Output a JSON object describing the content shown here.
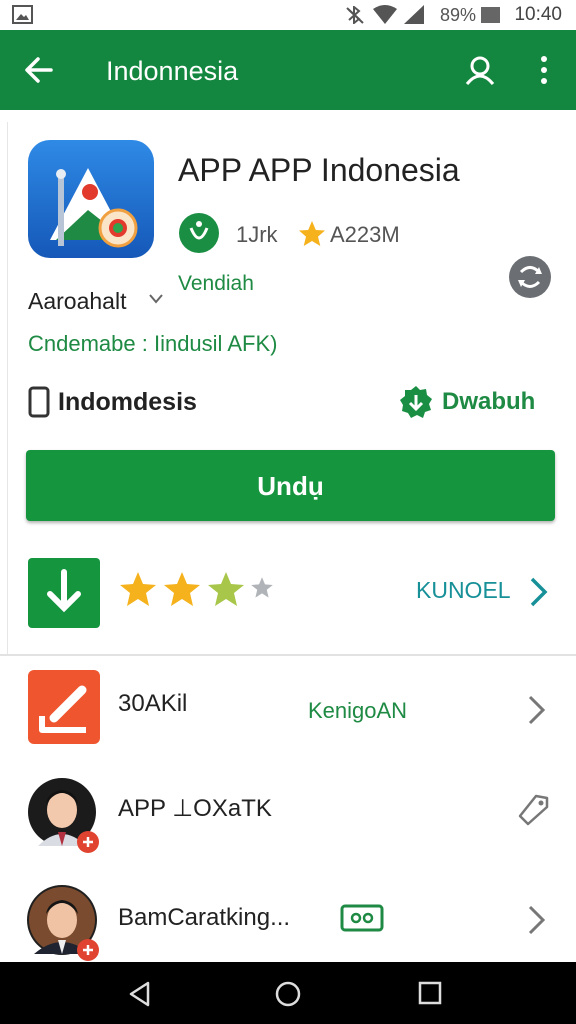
{
  "status_bar": {
    "battery": "89%",
    "time": "10:40"
  },
  "app_bar": {
    "title": "Indonnesia",
    "back_icon": "arrow-left-icon",
    "search_icon": "person-search-icon",
    "menu_icon": "more-vert-icon"
  },
  "app": {
    "title": "APP APP Indonesia",
    "meta_count": "1Jrk",
    "meta_size": "A223M",
    "vendor": "Vendiah",
    "age": "Aaroahalt",
    "compatibility": "Cndemabe : Iindusil AFK)",
    "device": "Indomdesis",
    "download_link": "Dwabuh"
  },
  "install": {
    "label": "Undụ"
  },
  "rating": {
    "stars": 3,
    "link": "KUNOEL"
  },
  "list": [
    {
      "label": "30AKil",
      "status": "KenigoAN"
    },
    {
      "label": "APP ⊥OXaTK"
    },
    {
      "label": "BamCaratking..."
    }
  ],
  "colors": {
    "primary": "#13873f",
    "button": "#16953f",
    "accent_link": "#1e8a43",
    "teal_link": "#179098",
    "star": "#f5b21c"
  }
}
